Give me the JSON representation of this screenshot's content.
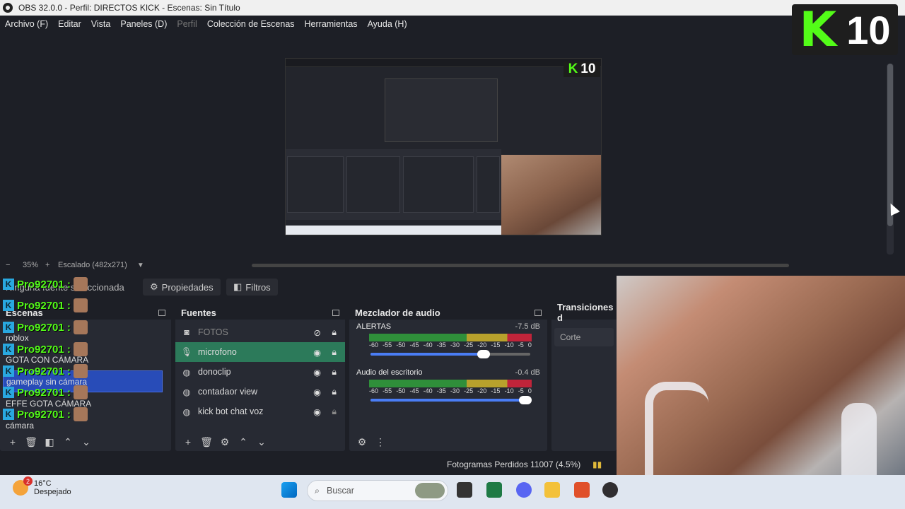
{
  "window": {
    "title": "OBS 32.0.0 - Perfil: DIRECTOS KICK - Escenas: Sin Título"
  },
  "menu": [
    {
      "label": "Archivo (F)",
      "disabled": false
    },
    {
      "label": "Editar",
      "disabled": false
    },
    {
      "label": "Vista",
      "disabled": false
    },
    {
      "label": "Paneles (D)",
      "disabled": false
    },
    {
      "label": "Perfil",
      "disabled": true
    },
    {
      "label": "Colección de Escenas",
      "disabled": false
    },
    {
      "label": "Herramientas",
      "disabled": false
    },
    {
      "label": "Ayuda (H)",
      "disabled": false
    }
  ],
  "overlay_badge": {
    "letter": "K",
    "count": "10"
  },
  "preview_badge": {
    "letter": "K",
    "count": "10"
  },
  "zoom": {
    "minus": "−",
    "level": "35%",
    "plus": "+",
    "scale": "Escalado (482x271)"
  },
  "source_toolbar": {
    "no_selection": "Ninguna fuente seleccionada",
    "properties": "Propiedades",
    "filters": "Filtros"
  },
  "scenes": {
    "title": "Escenas",
    "items": [
      {
        "label": "roblox",
        "selected": false
      },
      {
        "label": "GOTA CON CÁMARA",
        "selected": false
      },
      {
        "label": "gameplay sin cámara",
        "selected": true
      },
      {
        "label": "EFFE GOTA CÁMARA",
        "selected": false
      },
      {
        "label": "cámara",
        "selected": false
      }
    ],
    "chat_name": "Pro92701 :",
    "chat_badge": "K"
  },
  "sources": {
    "title": "Fuentes",
    "items": [
      {
        "label": "FOTOS",
        "icon": "camera-icon",
        "visible": false,
        "selected": false,
        "dim": true
      },
      {
        "label": "microfono",
        "icon": "mic-icon",
        "visible": true,
        "selected": true,
        "dim": false
      },
      {
        "label": "donoclip",
        "icon": "globe-icon",
        "visible": true,
        "selected": false,
        "dim": false
      },
      {
        "label": "contadaor view",
        "icon": "globe-icon",
        "visible": true,
        "selected": false,
        "dim": false
      },
      {
        "label": "kick bot chat voz",
        "icon": "globe-icon",
        "visible": true,
        "selected": false,
        "dim": false
      }
    ]
  },
  "mixer": {
    "title": "Mezclador de audio",
    "channels": [
      {
        "name": "ALERTAS",
        "db": "-7.5 dB",
        "volume": 0.71
      },
      {
        "name": "Audio del escritorio",
        "db": "-0.4 dB",
        "volume": 0.97
      }
    ],
    "ticks": [
      "-60",
      "-55",
      "-50",
      "-45",
      "-40",
      "-35",
      "-30",
      "-25",
      "-20",
      "-15",
      "-10",
      "-5",
      "0"
    ]
  },
  "transitions": {
    "title": "Transiciones d",
    "current": "Corte"
  },
  "status": {
    "dropped_frames": "Fotogramas Perdidos 11007 (4.5%)"
  },
  "taskbar": {
    "temp": "16°C",
    "weather": "Despejado",
    "weather_badge": "2",
    "search_placeholder": "Buscar"
  },
  "colors": {
    "kick_green": "#53fc18",
    "selection_blue": "#284cb8",
    "source_selected": "#2c7a5a"
  }
}
